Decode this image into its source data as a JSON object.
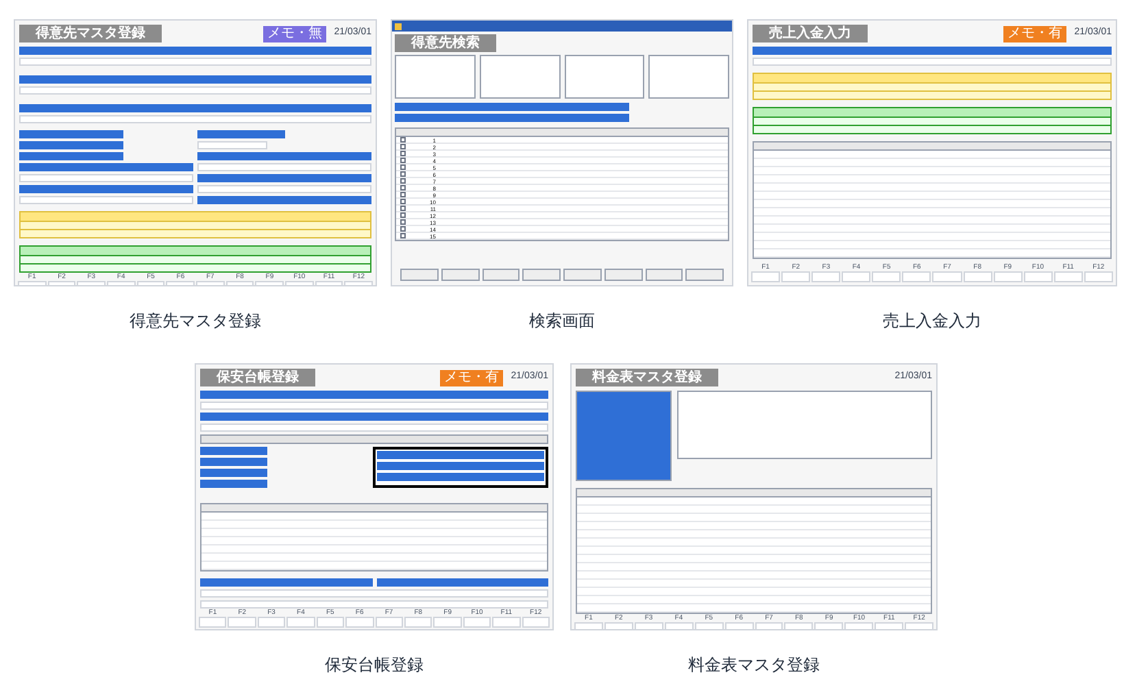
{
  "screens": [
    {
      "kind": "customer",
      "title": "得意先マスタ登録",
      "badge": {
        "text": "メモ・無",
        "on": false
      },
      "date": "21/03/01",
      "caption": "得意先マスタ登録",
      "keys": [
        "F1",
        "F2",
        "F3",
        "F4",
        "F5",
        "F6",
        "F7",
        "F8",
        "F9",
        "F10",
        "F11",
        "F12"
      ]
    },
    {
      "kind": "search",
      "title": "得意先検索",
      "caption": "検索画面",
      "rows": [
        {
          "no": "1",
          "checked": false
        },
        {
          "no": "2",
          "checked": false
        },
        {
          "no": "3",
          "checked": false
        },
        {
          "no": "4",
          "checked": false
        },
        {
          "no": "5",
          "checked": false
        },
        {
          "no": "6",
          "checked": false
        },
        {
          "no": "7",
          "checked": false
        },
        {
          "no": "8",
          "checked": false
        },
        {
          "no": "9",
          "checked": false
        },
        {
          "no": "10",
          "checked": false
        },
        {
          "no": "11",
          "checked": false
        },
        {
          "no": "12",
          "checked": false
        },
        {
          "no": "13",
          "checked": false
        },
        {
          "no": "14",
          "checked": false
        },
        {
          "no": "15",
          "checked": false
        }
      ]
    },
    {
      "kind": "sales",
      "title": "売上入金入力",
      "badge": {
        "text": "メモ・有",
        "on": true
      },
      "date": "21/03/01",
      "caption": "売上入金入力",
      "keys": [
        "F1",
        "F2",
        "F3",
        "F4",
        "F5",
        "F6",
        "F7",
        "F8",
        "F9",
        "F10",
        "F11",
        "F12"
      ]
    },
    {
      "kind": "ledger",
      "title": "保安台帳登録",
      "badge": {
        "text": "メモ・有",
        "on": true
      },
      "date": "21/03/01",
      "caption": "保安台帳登録",
      "keys": [
        "F1",
        "F2",
        "F3",
        "F4",
        "F5",
        "F6",
        "F7",
        "F8",
        "F9",
        "F10",
        "F11",
        "F12"
      ]
    },
    {
      "kind": "fee",
      "title": "料金表マスタ登録",
      "date": "21/03/01",
      "caption": "料金表マスタ登録",
      "keys": [
        "F1",
        "F2",
        "F3",
        "F4",
        "F5",
        "F6",
        "F7",
        "F8",
        "F9",
        "F10",
        "F11",
        "F12"
      ]
    }
  ]
}
